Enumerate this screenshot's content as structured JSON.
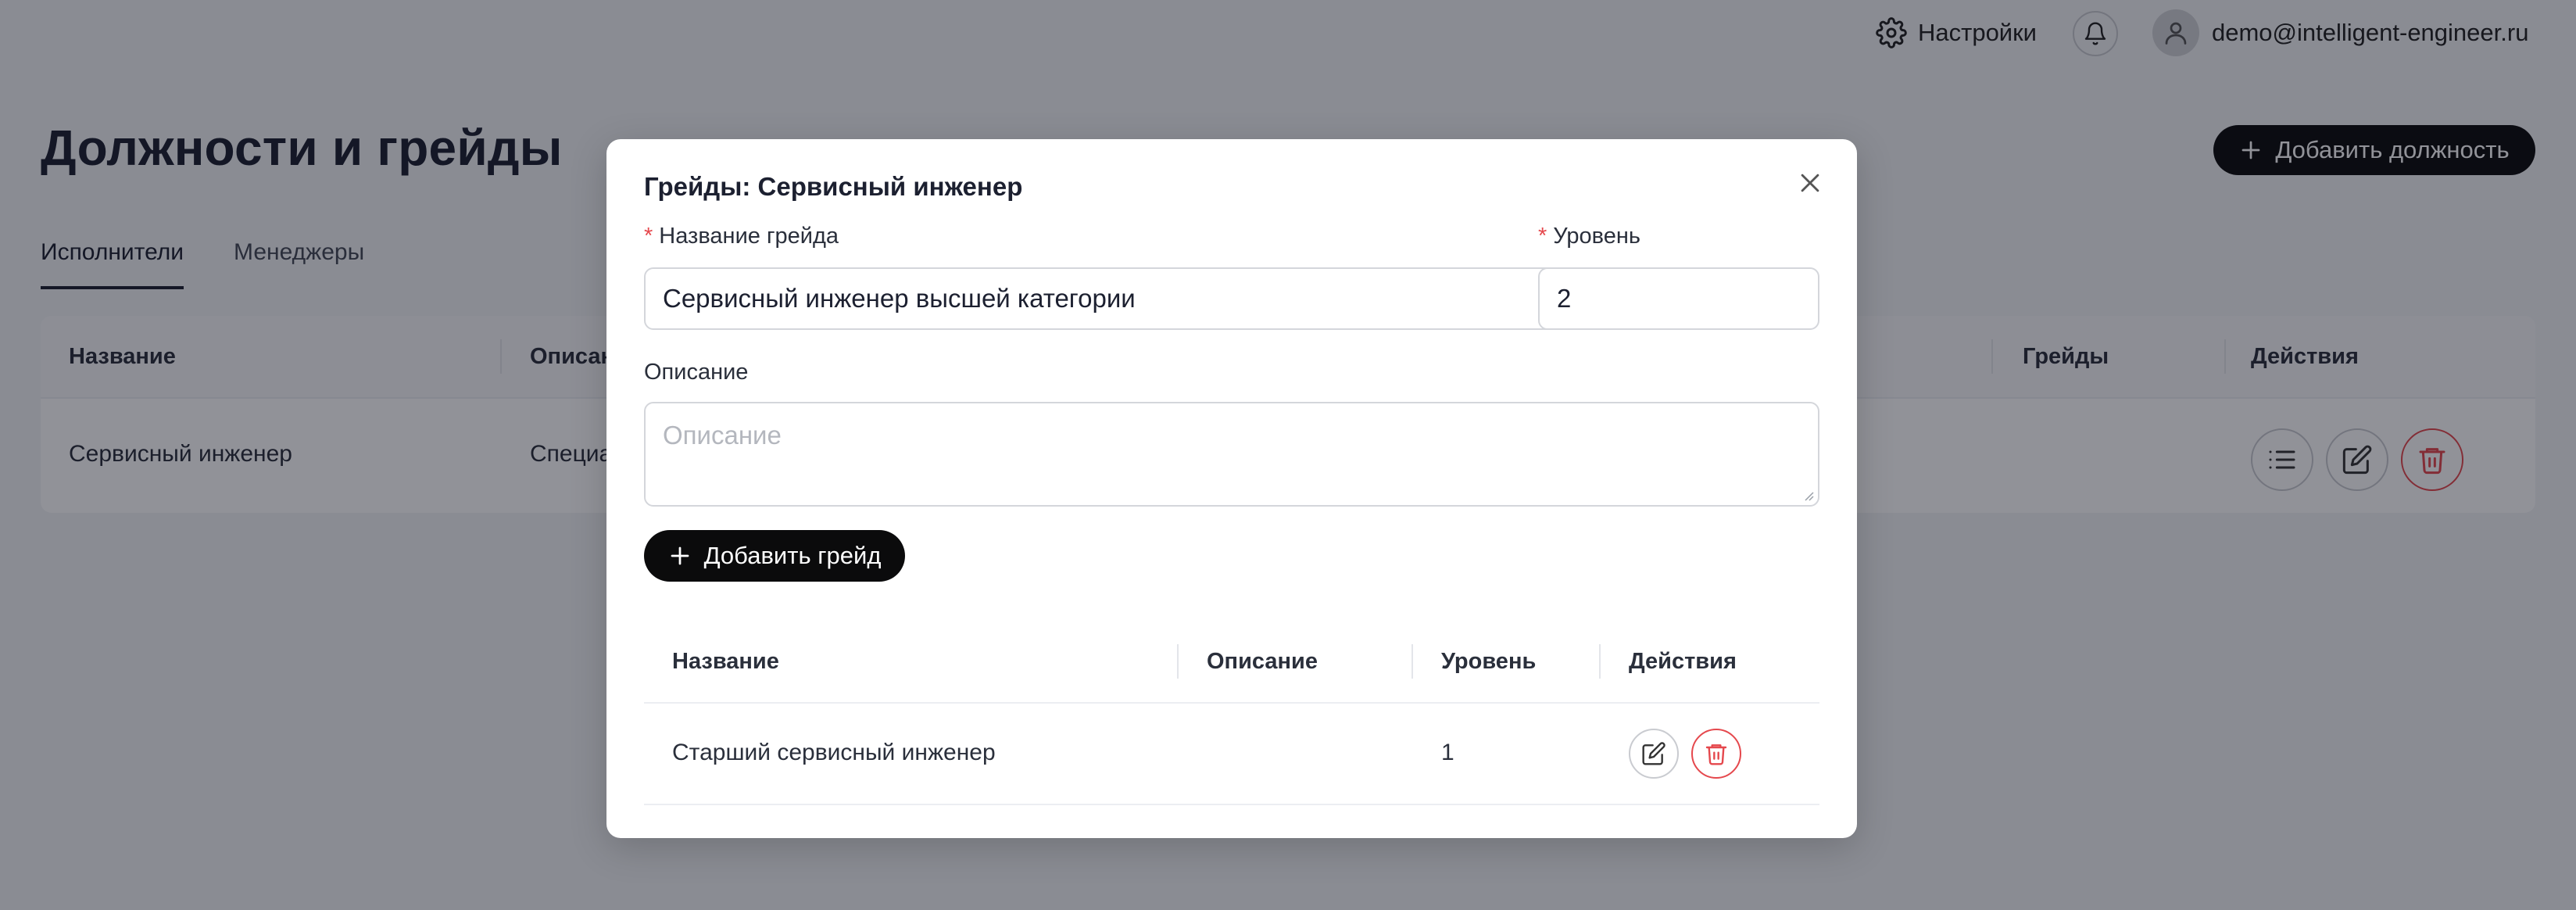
{
  "topbar": {
    "settings_label": "Настройки",
    "user_email": "demo@intelligent-engineer.ru"
  },
  "page": {
    "title": "Должности и грейды",
    "add_position_label": "Добавить должность",
    "tabs": [
      {
        "label": "Исполнители",
        "active": true
      },
      {
        "label": "Менеджеры",
        "active": false
      }
    ],
    "table": {
      "columns": [
        "Название",
        "Описан",
        "Грейды",
        "Действия"
      ],
      "rows": [
        {
          "name": "Сервисный инженер",
          "description": "Специа"
        }
      ]
    }
  },
  "modal": {
    "title": "Грейды: Сервисный инженер",
    "grade_name_label": "Название грейда",
    "grade_name_value": "Сервисный инженер высшей категории",
    "level_label": "Уровень",
    "level_value": "2",
    "description_label": "Описание",
    "description_placeholder": "Описание",
    "add_grade_label": "Добавить грейд",
    "grades_table": {
      "columns": [
        "Название",
        "Описание",
        "Уровень",
        "Действия"
      ],
      "rows": [
        {
          "name": "Старший сервисный инженер",
          "description": "",
          "level": "1"
        }
      ]
    }
  },
  "colors": {
    "primary_button": "#0b0b0c",
    "danger": "#e5484d",
    "required_mark": "#e5484d"
  },
  "icons": {
    "settings": "gear-icon",
    "notifications": "bell-icon",
    "user": "user-icon",
    "add": "plus-icon",
    "close": "close-icon",
    "list": "list-icon",
    "edit": "edit-icon",
    "delete": "trash-icon"
  }
}
